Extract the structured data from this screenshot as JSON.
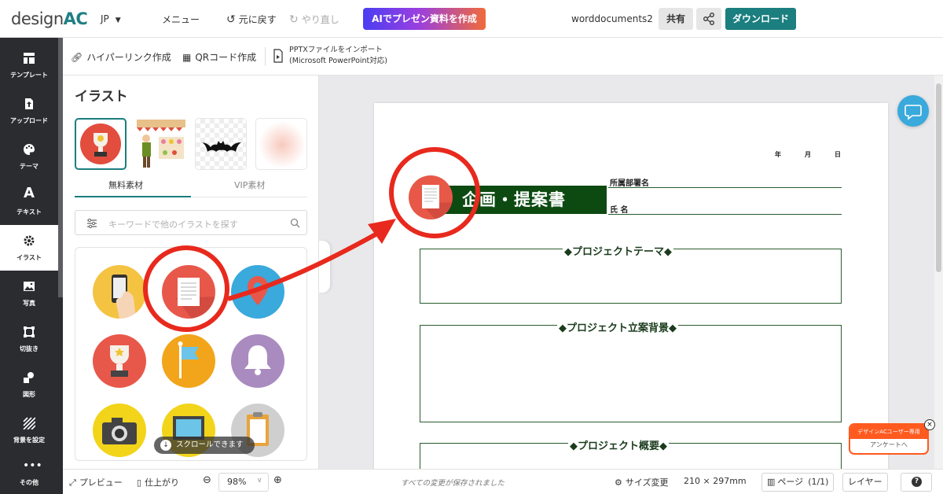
{
  "brand": {
    "logo_prefix": "design",
    "logo_suffix": "AC"
  },
  "header": {
    "lang": "JP",
    "menu": "メニュー",
    "undo": "元に戻す",
    "redo": "やり直し",
    "ai_button": "AIでプレゼン資料を作成",
    "doc_name": "worddocuments2",
    "share": "共有",
    "download": "ダウンロード",
    "colors": {
      "accent": "#1b7e7f",
      "nav_bg": "#2b2c30"
    }
  },
  "toolbar": {
    "hyperlink": "ハイパーリンク作成",
    "qr": "QRコード作成",
    "pptx_line1": "PPTXファイルをインポート",
    "pptx_line2": "(Microsoft PowerPoint対応)"
  },
  "nav": {
    "items": [
      {
        "label": "テンプレート",
        "icon": "template-icon"
      },
      {
        "label": "アップロード",
        "icon": "upload-icon"
      },
      {
        "label": "テーマ",
        "icon": "palette-icon"
      },
      {
        "label": "テキスト",
        "icon": "text-icon"
      },
      {
        "label": "イラスト",
        "icon": "gear-icon",
        "active": true
      },
      {
        "label": "写真",
        "icon": "photo-icon"
      },
      {
        "label": "切抜き",
        "icon": "crop-icon"
      },
      {
        "label": "図形",
        "icon": "shapes-icon"
      },
      {
        "label": "背景を設定",
        "icon": "background-icon"
      },
      {
        "label": "その他",
        "icon": "more-icon"
      }
    ]
  },
  "panel": {
    "title": "イラスト",
    "tab_free": "無料素材",
    "tab_vip": "VIP素材",
    "search_placeholder": "キーワードで他のイラストを探す",
    "scroll_hint": "スクロールできます"
  },
  "document": {
    "date_year": "年",
    "date_month": "月",
    "date_day": "日",
    "title": "企画・提案書",
    "dept_label": "所属部署名",
    "name_label": "氏 名",
    "sections": [
      "◆プロジェクトテーマ◆",
      "◆プロジェクト立案背景◆",
      "◆プロジェクト概要◆"
    ]
  },
  "survey": {
    "top": "デザインACユーザー専用",
    "bottom": "アンケートへ",
    "close": "×"
  },
  "footer": {
    "preview": "プレビュー",
    "finish": "仕上がり",
    "zoom": "98%",
    "saved": "すべての変更が保存されました",
    "size_label": "サイズ変更",
    "size_value": "210 × 297mm",
    "page_label": "ページ",
    "page_count": "(1/1)",
    "layer": "レイヤー",
    "help": "?"
  }
}
